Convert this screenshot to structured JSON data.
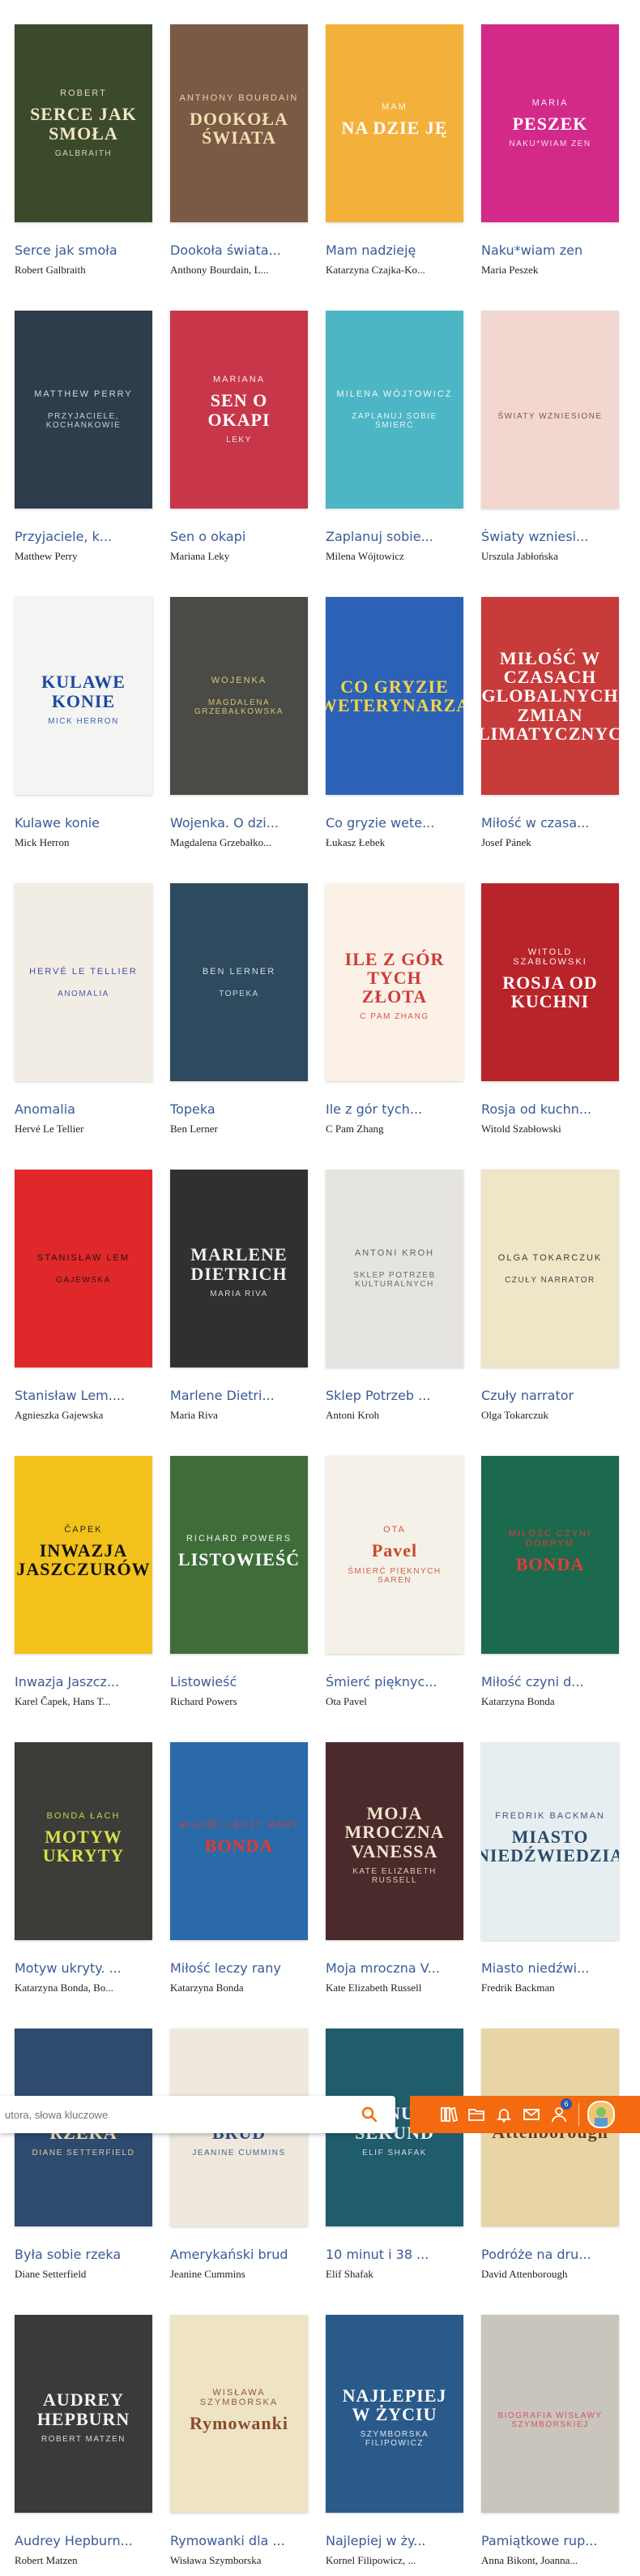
{
  "books": [
    {
      "title": "Serce jak smoła",
      "author": "Robert Galbraith",
      "cover_top": "Robert",
      "cover_main": "SERCE JAK SMOŁA",
      "cover_bot": "Galbraith",
      "bg": "#3c4a2c",
      "fg": "#f2e7c4"
    },
    {
      "title": "Dookoła świata...",
      "author": "Anthony Bourdain, L...",
      "cover_top": "Anthony Bourdain",
      "cover_main": "DOOKOŁA ŚWIATA",
      "cover_bot": "",
      "bg": "#7a5a44",
      "fg": "#f4e0b0"
    },
    {
      "title": "Mam nadzieję",
      "author": "Katarzyna Czajka-Ko...",
      "cover_top": "Mam",
      "cover_main": "NA DZIE JĘ",
      "cover_bot": "",
      "bg": "#f3b13c",
      "fg": "#ffffff"
    },
    {
      "title": "Naku*wiam zen",
      "author": "Maria Peszek",
      "cover_top": "Maria",
      "cover_main": "PESZEK",
      "cover_bot": "NAKU*WIAM ZEN",
      "bg": "#d32a8a",
      "fg": "#ffffff"
    },
    {
      "title": "Przyjaciele, k...",
      "author": "Matthew Perry",
      "cover_top": "Matthew Perry",
      "cover_main": "",
      "cover_bot": "Przyjaciele, kochankowie",
      "bg": "#2d3d4c",
      "fg": "#e8e8e8"
    },
    {
      "title": "Sen o okapi",
      "author": "Mariana Leky",
      "cover_top": "Mariana",
      "cover_main": "SEN O OKAPI",
      "cover_bot": "Leky",
      "bg": "#c8364a",
      "fg": "#ffffff"
    },
    {
      "title": "Zaplanuj sobie...",
      "author": "Milena Wójtowicz",
      "cover_top": "Milena Wójtowicz",
      "cover_main": "",
      "cover_bot": "Zaplanuj sobie śmierć",
      "bg": "#4db6c4",
      "fg": "#ffffff"
    },
    {
      "title": "Światy wzniesi...",
      "author": "Urszula Jabłońska",
      "cover_top": "",
      "cover_main": "",
      "cover_bot": "Światy wzniesione",
      "bg": "#f1d7cf",
      "fg": "#7a3a2a"
    },
    {
      "title": "Kulawe konie",
      "author": "Mick Herron",
      "cover_top": "",
      "cover_main": "KULAWE KONIE",
      "cover_bot": "Mick Herron",
      "bg": "#f4f4f2",
      "fg": "#1a4aa0"
    },
    {
      "title": "Wojenka. O dzi...",
      "author": "Magdalena Grzebałko...",
      "cover_top": "Wojenka",
      "cover_main": "",
      "cover_bot": "Magdalena Grzebałkowska",
      "bg": "#4a4a46",
      "fg": "#e6d97a"
    },
    {
      "title": "Co gryzie wete...",
      "author": "Łukasz Łebek",
      "cover_top": "",
      "cover_main": "CO GRYZIE WETERYNARZA",
      "cover_bot": "",
      "bg": "#2b62b8",
      "fg": "#f5d34a"
    },
    {
      "title": "Miłość w czasa...",
      "author": "Josef Pánek",
      "cover_top": "",
      "cover_main": "MIŁOŚĆ W CZASACH GLOBALNYCH ZMIAN KLIMATYCZNYCH",
      "cover_bot": "",
      "bg": "#c83b3b",
      "fg": "#ffffff"
    },
    {
      "title": "Anomalia",
      "author": "Hervé Le Tellier",
      "cover_top": "Hervé Le Tellier",
      "cover_main": "",
      "cover_bot": "ANOMALIA",
      "bg": "#f2ede4",
      "fg": "#2a3aa8"
    },
    {
      "title": "Topeka",
      "author": "Ben Lerner",
      "cover_top": "Ben Lerner",
      "cover_main": "",
      "cover_bot": "Topeka",
      "bg": "#2e4a5e",
      "fg": "#e6ecf0"
    },
    {
      "title": "Ile z gór tych...",
      "author": "C Pam Zhang",
      "cover_top": "",
      "cover_main": "ILE Z GÓR TYCH ZŁOTA",
      "cover_bot": "C Pam Zhang",
      "bg": "#fbf1e6",
      "fg": "#cf3a3a"
    },
    {
      "title": "Rosja od kuchn...",
      "author": "Witold Szabłowski",
      "cover_top": "Witold Szabłowski",
      "cover_main": "ROSJA OD KUCHNI",
      "cover_bot": "",
      "bg": "#b8242a",
      "fg": "#ffffff"
    },
    {
      "title": "Stanisław Lem....",
      "author": "Agnieszka Gajewska",
      "cover_top": "Stanisław Lem",
      "cover_main": "",
      "cover_bot": "Gajewska",
      "bg": "#e0282a",
      "fg": "#111111"
    },
    {
      "title": "Marlene Dietri...",
      "author": "Maria Riva",
      "cover_top": "",
      "cover_main": "MARLENE DIETRICH",
      "cover_bot": "Maria Riva",
      "bg": "#303030",
      "fg": "#f0f0f0"
    },
    {
      "title": "Sklep Potrzeb ...",
      "author": "Antoni Kroh",
      "cover_top": "Antoni Kroh",
      "cover_main": "",
      "cover_bot": "Sklep Potrzeb Kulturalnych",
      "bg": "#e6e4e0",
      "fg": "#555555"
    },
    {
      "title": "Czuły narrator",
      "author": "Olga Tokarczuk",
      "cover_top": "Olga Tokarczuk",
      "cover_main": "",
      "cover_bot": "Czuły narrator",
      "bg": "#efe5c7",
      "fg": "#2a2a2a"
    },
    {
      "title": "Inwazja Jaszcz...",
      "author": "Karel Čapek, Hans T...",
      "cover_top": "Čapek",
      "cover_main": "INWAZJA JASZCZURÓW",
      "cover_bot": "",
      "bg": "#f2c21a",
      "fg": "#111111"
    },
    {
      "title": "Listowieść",
      "author": "Richard Powers",
      "cover_top": "Richard Powers",
      "cover_main": "LISTOWIEŚĆ",
      "cover_bot": "",
      "bg": "#3f6d3a",
      "fg": "#ffffff"
    },
    {
      "title": "Śmierć pięknyc...",
      "author": "Ota Pavel",
      "cover_top": "Ota",
      "cover_main": "Pavel",
      "cover_bot": "Śmierć pięknych saren",
      "bg": "#f5f1e8",
      "fg": "#c54a2a"
    },
    {
      "title": "Miłość czyni d...",
      "author": "Katarzyna Bonda",
      "cover_top": "miłość czyni dobrym",
      "cover_main": "BONDA",
      "cover_bot": "",
      "bg": "#1c6a4e",
      "fg": "#e63a3a"
    },
    {
      "title": "Motyw ukryty. ...",
      "author": "Katarzyna Bonda, Bo...",
      "cover_top": "Bonda Łach",
      "cover_main": "MOTYW UKRYTY",
      "cover_bot": "",
      "bg": "#3c3c38",
      "fg": "#d7e04a"
    },
    {
      "title": "Miłość leczy rany",
      "author": "Katarzyna Bonda",
      "cover_top": "miłość leczy rany",
      "cover_main": "BONDA",
      "cover_bot": "",
      "bg": "#2a6aa8",
      "fg": "#e23a2e"
    },
    {
      "title": "Moja mroczna V...",
      "author": "Kate Elizabeth Russell",
      "cover_top": "",
      "cover_main": "MOJA MROCZNA VANESSA",
      "cover_bot": "Kate Elizabeth Russell",
      "bg": "#4a2a2a",
      "fg": "#f2e5d0"
    },
    {
      "title": "Miasto niedźwi...",
      "author": "Fredrik Backman",
      "cover_top": "Fredrik Backman",
      "cover_main": "MIASTO NIEDŹWIEDZIA",
      "cover_bot": "",
      "bg": "#e6eef2",
      "fg": "#2a4a6a"
    },
    {
      "title": "Była sobie rzeka",
      "author": "Diane Setterfield",
      "cover_top": "",
      "cover_main": "BYŁA SOBIE RZEKA",
      "cover_bot": "Diane Setterfield",
      "bg": "#2e4a6e",
      "fg": "#f2e3b0"
    },
    {
      "title": "Amerykański brud",
      "author": "Jeanine Cummins",
      "cover_top": "",
      "cover_main": "AMERYKAŃSKI BRUD",
      "cover_bot": "Jeanine Cummins",
      "bg": "#efe8dc",
      "fg": "#2a4a8a"
    },
    {
      "title": "10 minut i 38 ...",
      "author": "Elif Shafak",
      "cover_top": "",
      "cover_main": "10 MINUT 38 SEKUND",
      "cover_bot": "Elif Shafak",
      "bg": "#1f5c6c",
      "fg": "#f2f2f2"
    },
    {
      "title": "Podróże na dru...",
      "author": "David Attenborough",
      "cover_top": "David",
      "cover_main": "Attenborough",
      "cover_bot": "",
      "bg": "#e8d5a6",
      "fg": "#6a3a1a"
    },
    {
      "title": "Audrey Hepburn...",
      "author": "Robert Matzen",
      "cover_top": "",
      "cover_main": "AUDREY HEPBURN",
      "cover_bot": "Robert Matzen",
      "bg": "#3a3a3a",
      "fg": "#f2f2f2"
    },
    {
      "title": "Rymowanki dla ...",
      "author": "Wisława Szymborska",
      "cover_top": "Wisława Szymborska",
      "cover_main": "Rymowanki",
      "cover_bot": "",
      "bg": "#efe3c6",
      "fg": "#8a4a2a"
    },
    {
      "title": "Najlepiej w ży...",
      "author": "Kornel Filipowicz, ...",
      "cover_top": "",
      "cover_main": "NAJLEPIEJ W ŻYCIU",
      "cover_bot": "Szymborska Filipowicz",
      "bg": "#2a5a8a",
      "fg": "#ffffff"
    },
    {
      "title": "Pamiątkowe rup...",
      "author": "Anna Bikont, Joanna...",
      "cover_top": "",
      "cover_main": "",
      "cover_bot": "Biografia Wisławy Szymborskiej",
      "bg": "#c9c4bc",
      "fg": "#e23a5a"
    }
  ],
  "toolbar": {
    "search_placeholder": "utora, słowa kluczowe",
    "notification_count": "6",
    "accent": "#f36a10"
  }
}
